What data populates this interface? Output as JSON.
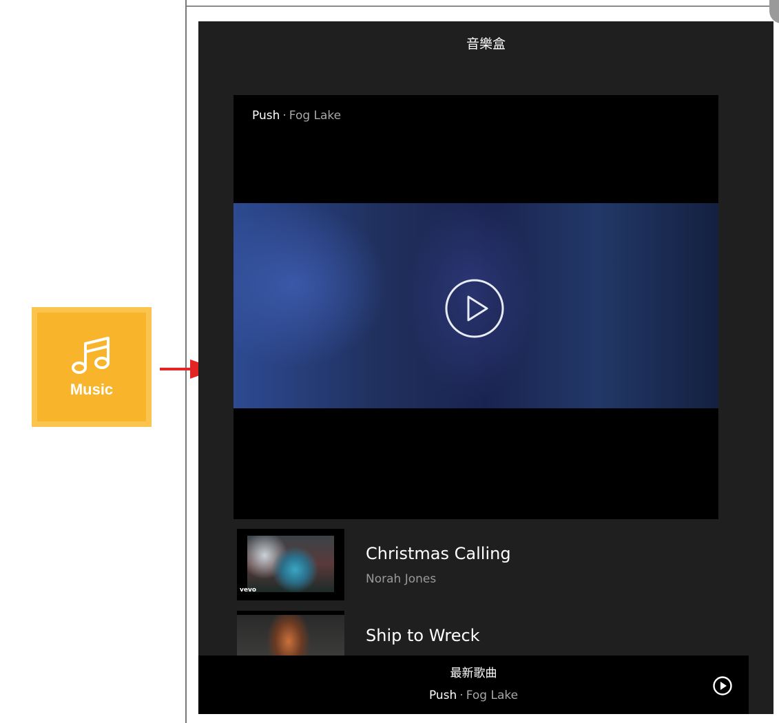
{
  "music_tile": {
    "label": "Music",
    "icon": "music-note-icon"
  },
  "app": {
    "title": "音樂盒",
    "now_playing": {
      "title": "Push",
      "separator": "·",
      "artist": "Fog Lake"
    },
    "playlist": [
      {
        "title": "Christmas Calling",
        "artist": "Norah Jones",
        "thumb_badge": "vevo"
      },
      {
        "title": "Ship to Wreck",
        "artist": ""
      }
    ],
    "bottom_bar": {
      "label": "最新歌曲",
      "title": "Push",
      "separator": "·",
      "artist": "Fog Lake"
    }
  },
  "colors": {
    "tile_bg": "#f8b52b",
    "app_bg": "#1f1f1f",
    "arrow": "#e32424"
  }
}
